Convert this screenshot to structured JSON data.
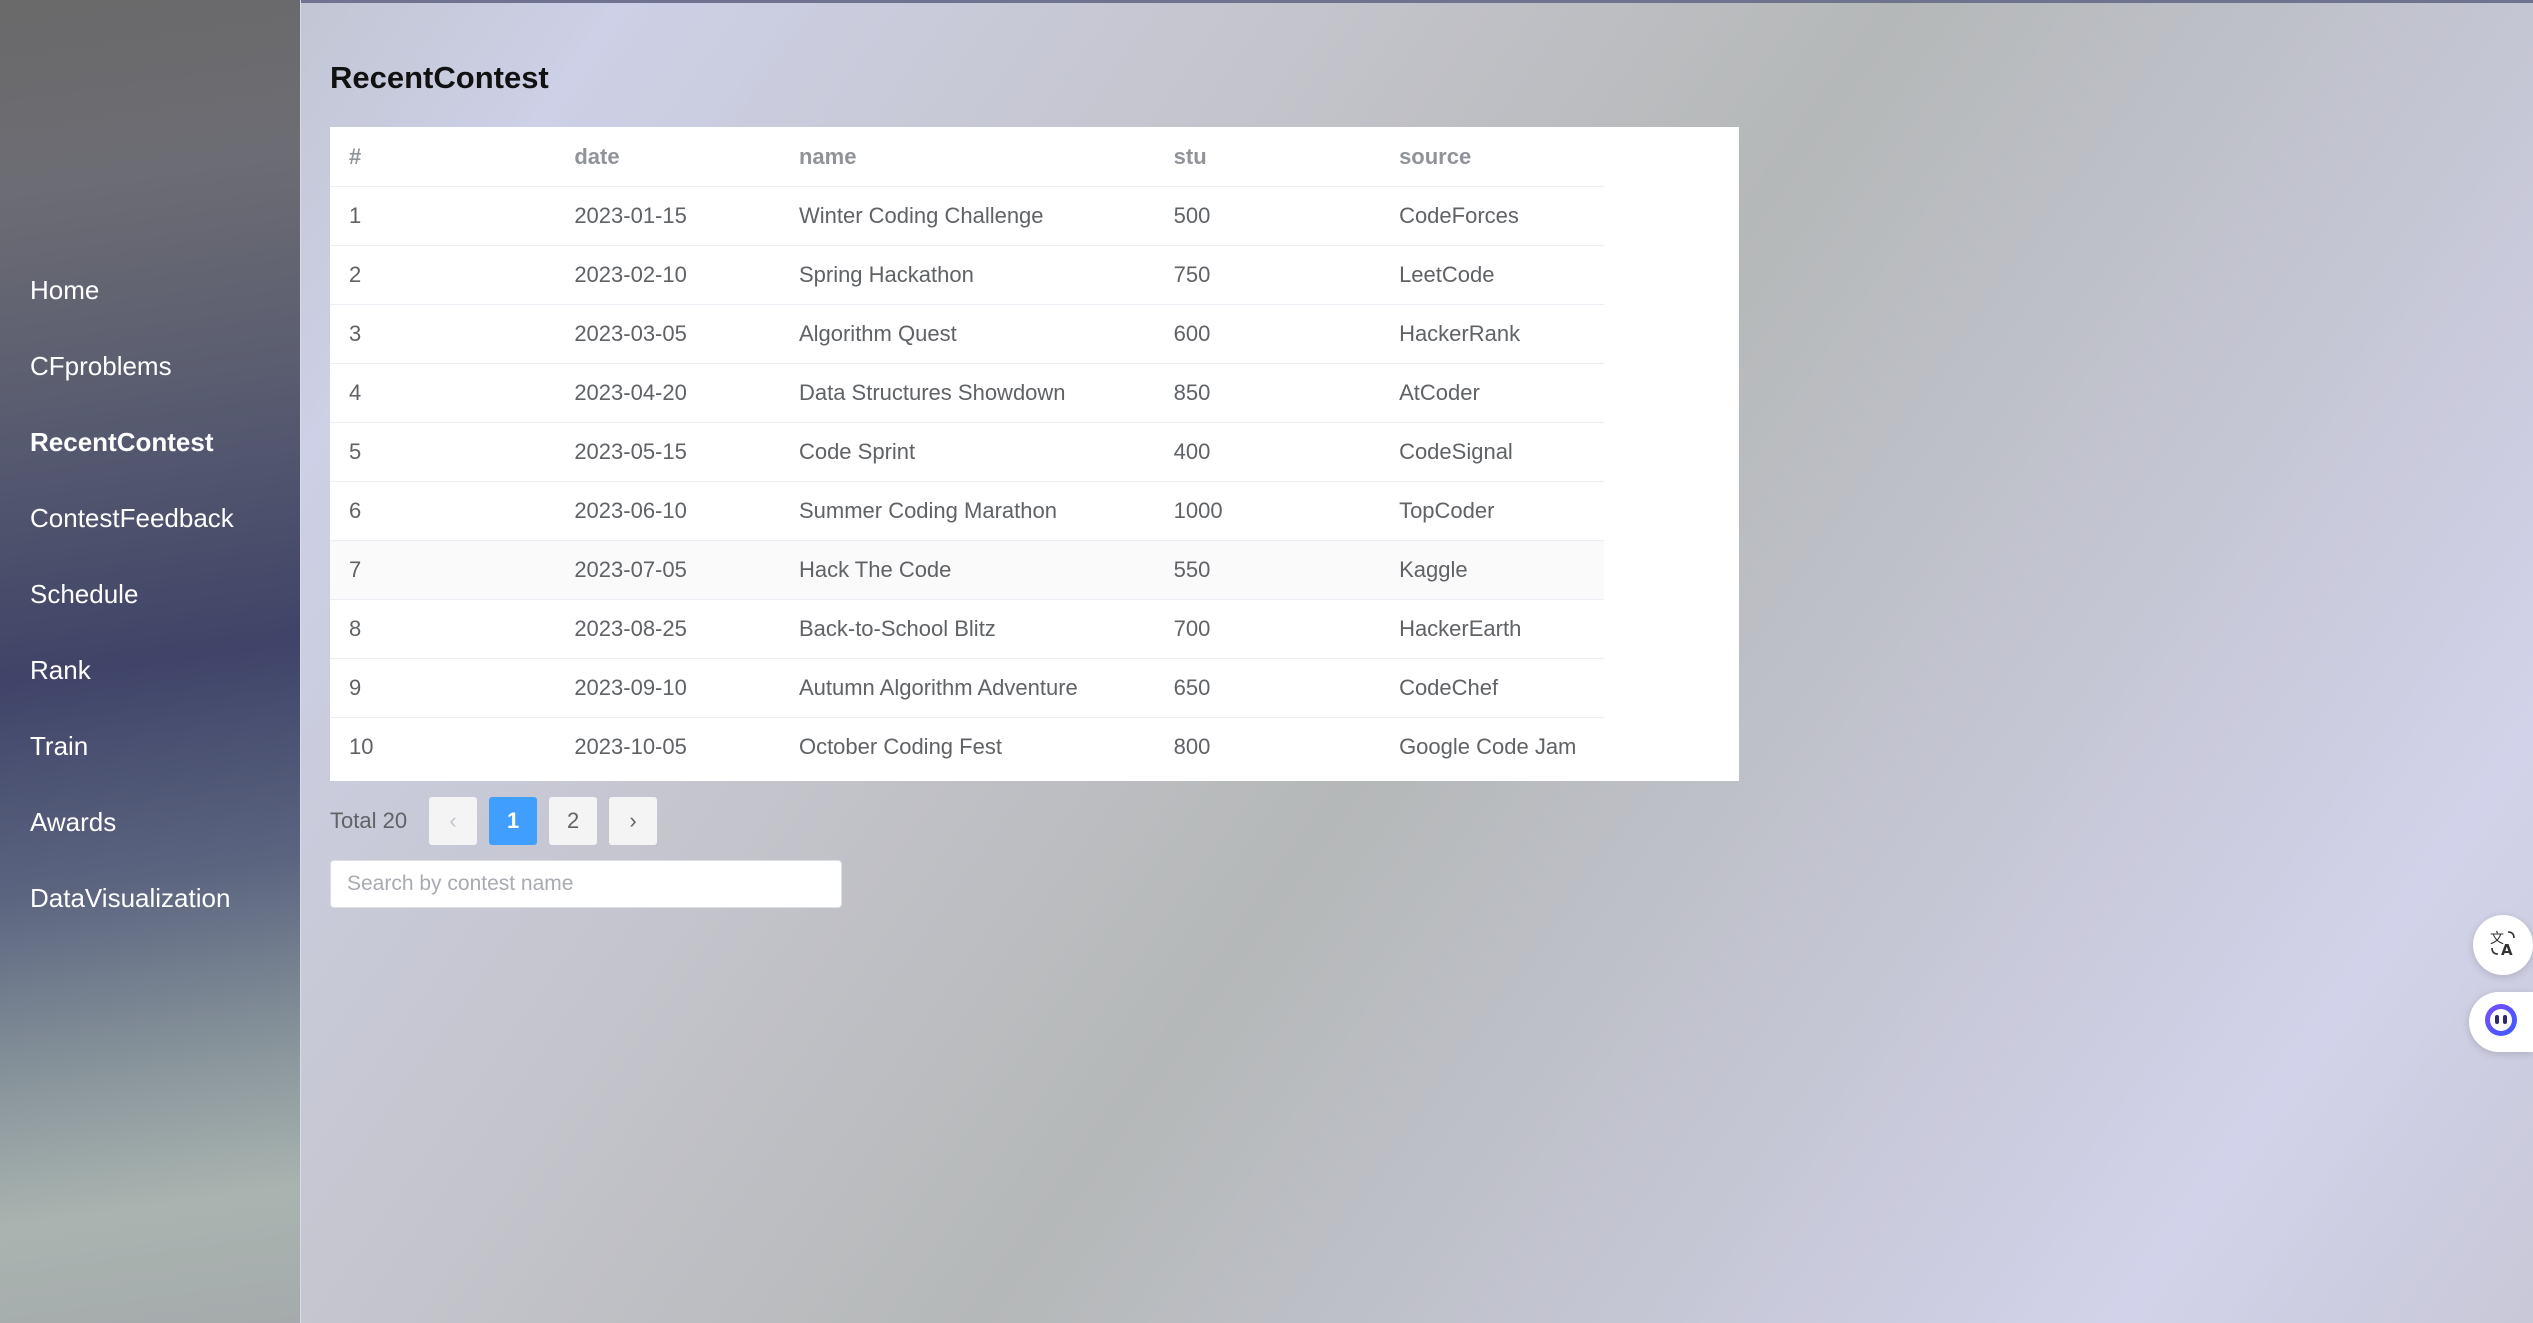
{
  "sidebar": {
    "items": [
      {
        "label": "Home",
        "active": false
      },
      {
        "label": "CFproblems",
        "active": false
      },
      {
        "label": "RecentContest",
        "active": true
      },
      {
        "label": "ContestFeedback",
        "active": false
      },
      {
        "label": "Schedule",
        "active": false
      },
      {
        "label": "Rank",
        "active": false
      },
      {
        "label": "Train",
        "active": false
      },
      {
        "label": "Awards",
        "active": false
      },
      {
        "label": "DataVisualization",
        "active": false
      }
    ]
  },
  "main": {
    "title": "RecentContest",
    "table": {
      "columns": [
        "#",
        "date",
        "name",
        "stu",
        "source"
      ],
      "rows": [
        [
          "1",
          "2023-01-15",
          "Winter Coding Challenge",
          "500",
          "CodeForces"
        ],
        [
          "2",
          "2023-02-10",
          "Spring Hackathon",
          "750",
          "LeetCode"
        ],
        [
          "3",
          "2023-03-05",
          "Algorithm Quest",
          "600",
          "HackerRank"
        ],
        [
          "4",
          "2023-04-20",
          "Data Structures Showdown",
          "850",
          "AtCoder"
        ],
        [
          "5",
          "2023-05-15",
          "Code Sprint",
          "400",
          "CodeSignal"
        ],
        [
          "6",
          "2023-06-10",
          "Summer Coding Marathon",
          "1000",
          "TopCoder"
        ],
        [
          "7",
          "2023-07-05",
          "Hack The Code",
          "550",
          "Kaggle"
        ],
        [
          "8",
          "2023-08-25",
          "Back-to-School Blitz",
          "700",
          "HackerEarth"
        ],
        [
          "9",
          "2023-09-10",
          "Autumn Algorithm Adventure",
          "650",
          "CodeChef"
        ],
        [
          "10",
          "2023-10-05",
          "October Coding Fest",
          "800",
          "Google Code Jam"
        ]
      ]
    },
    "pagination": {
      "total_label": "Total 20",
      "prev_icon": "‹",
      "next_icon": "›",
      "pages": [
        "1",
        "2"
      ],
      "current_page": "1"
    },
    "search": {
      "placeholder": "Search by contest name",
      "value": ""
    }
  },
  "floating": {
    "translate_icon": "translate-icon",
    "assistant_icon": "assistant-icon"
  },
  "colors": {
    "accent": "#409eff",
    "header_text": "#909399",
    "cell_text": "#5f6266"
  }
}
